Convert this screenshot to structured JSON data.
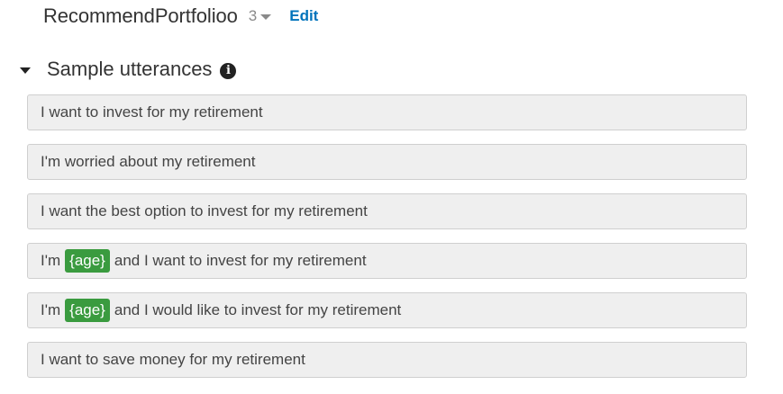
{
  "intent": {
    "name": "RecommendPortfolioo",
    "version": "3",
    "edit_label": "Edit"
  },
  "sample_utterances": {
    "title": "Sample utterances",
    "info_icon": "info-icon",
    "collapse_icon": "caret-down-icon",
    "slot_color": "#3a9b3f",
    "items": [
      {
        "text": "I want to invest for my retirement"
      },
      {
        "text": "I'm worried about my retirement"
      },
      {
        "text": "I want the best option to invest for my retirement"
      },
      {
        "prefix": "I'm",
        "slot": "{age}",
        "suffix": "and I want to invest for my retirement"
      },
      {
        "prefix": "I'm",
        "slot": "{age}",
        "suffix": "and I would like to invest for my retirement"
      },
      {
        "text": "I want to save money for my retirement"
      }
    ]
  }
}
